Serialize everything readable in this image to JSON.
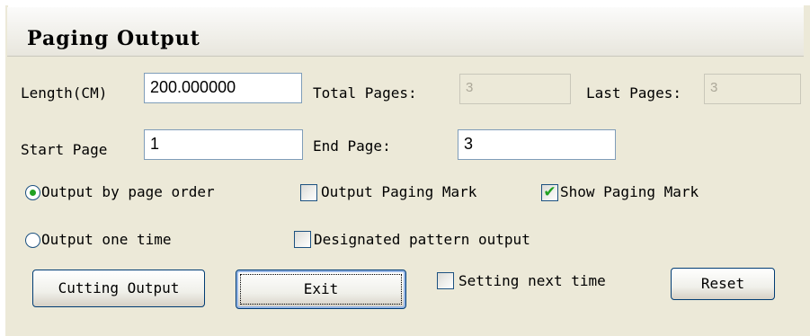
{
  "window": {
    "title": "Paging Output"
  },
  "fields": {
    "length": {
      "label": "Length(CM)",
      "value": "200.000000"
    },
    "total_pages": {
      "label": "Total Pages:",
      "value": "3"
    },
    "last_pages": {
      "label": "Last Pages:",
      "value": "3"
    },
    "start_page": {
      "label": "Start Page",
      "value": "1"
    },
    "end_page": {
      "label": "End Page:",
      "value": "3"
    }
  },
  "options": {
    "output_by_page_order": {
      "label": "Output by page order",
      "selected": true
    },
    "output_one_time": {
      "label": "Output one time",
      "selected": false
    },
    "output_paging_mark": {
      "label": "Output Paging Mark",
      "checked": false
    },
    "show_paging_mark": {
      "label": "Show Paging Mark",
      "checked": true
    },
    "designated_pattern_output": {
      "label": "Designated pattern output",
      "checked": false
    },
    "setting_next_time": {
      "label": "Setting next time",
      "checked": false
    }
  },
  "buttons": {
    "cutting_output": "Cutting Output",
    "exit": "Exit",
    "reset": "Reset"
  },
  "icons": {
    "checkmark": "✔"
  },
  "colors": {
    "accent_green": "#21a121",
    "control_border": "#1c5180",
    "panel_bg": "#ece9d8"
  }
}
